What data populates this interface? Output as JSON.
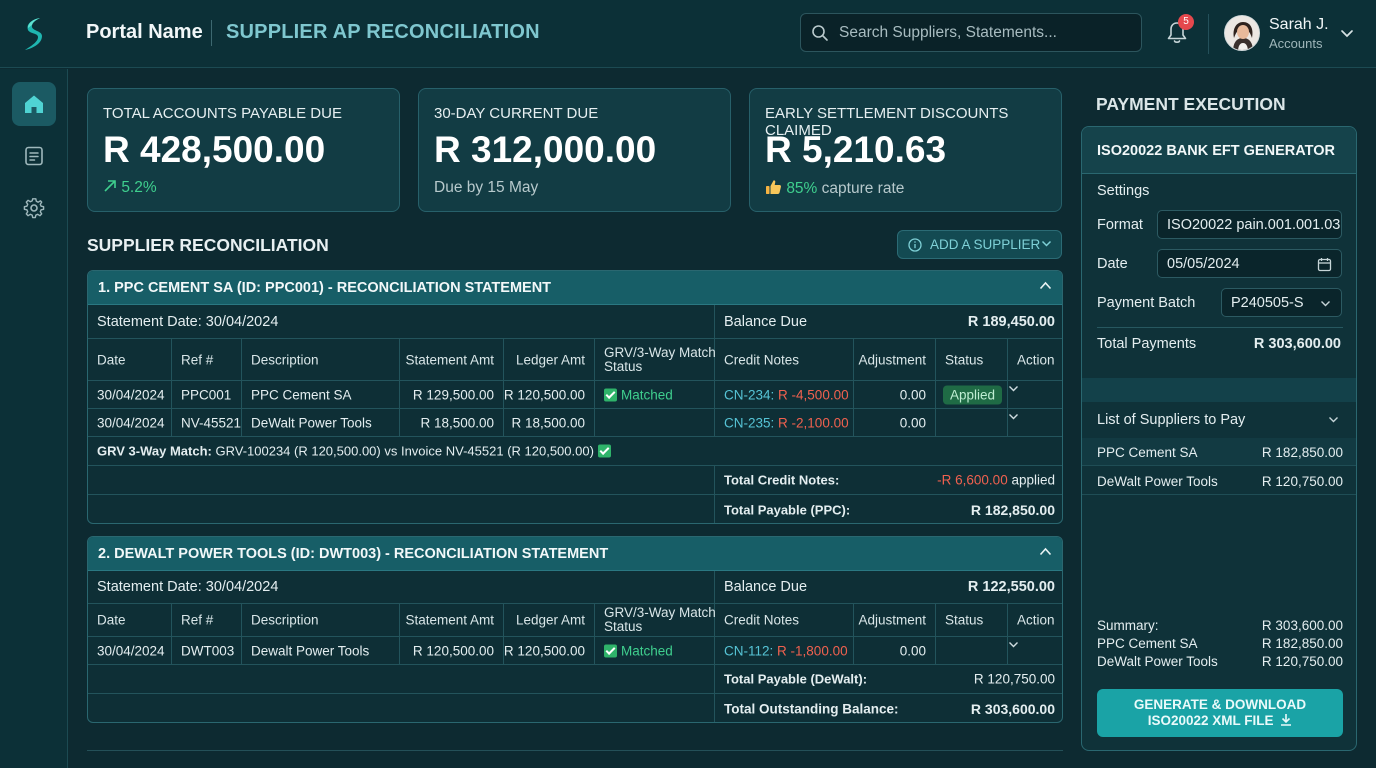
{
  "topbar": {
    "portal_name": "Portal Name",
    "page_title": "SUPPLIER AP RECONCILIATION",
    "search_placeholder": "Search Suppliers, Statements...",
    "notification_count": "5",
    "user_name": "Sarah J.",
    "user_role": "Accounts"
  },
  "sidebar": {
    "items": [
      {
        "icon": "home-icon",
        "active": true
      },
      {
        "icon": "document-icon",
        "active": false
      },
      {
        "icon": "gear-icon",
        "active": false
      }
    ]
  },
  "kpis": [
    {
      "label": "TOTAL ACCOUNTS PAYABLE DUE",
      "value": "R 428,500.00",
      "sub": "5.2%",
      "sub_icon": "arrow-up-right-icon"
    },
    {
      "label": "30-DAY CURRENT DUE",
      "value": "R 312,000.00",
      "sub": "Due by 15 May"
    },
    {
      "label": "EARLY SETTLEMENT DISCOUNTS CLAIMED",
      "value": "R 5,210.63",
      "sub_highlight": "85%",
      "sub_rest": " capture rate",
      "sub_icon": "thumbs-up-icon"
    }
  ],
  "reconciliation": {
    "title": "SUPPLIER RECONCILIATION",
    "add_button": "ADD A SUPPLIER",
    "columns": {
      "date": "Date",
      "ref": "Ref #",
      "description": "Description",
      "statement_amt": "Statement Amt",
      "ledger_amt": "Ledger Amt",
      "grv_line1": "GRV/3-Way Match",
      "grv_line2": "Status",
      "credit_notes": "Credit Notes",
      "adjustment": "Adjustment",
      "status": "Status",
      "action": "Action"
    },
    "statements": [
      {
        "title": "1. PPC CEMENT SA (ID: PPC001) - RECONCILIATION STATEMENT",
        "statement_date": "Statement Date: 30/04/2024",
        "balance_label": "Balance Due",
        "balance_value": "R 189,450.00",
        "rows": [
          {
            "date": "30/04/2024",
            "ref": "PPC001",
            "description": "PPC Cement SA",
            "statement_amt": "R 129,500.00",
            "ledger_amt": "R 120,500.00",
            "grv": "Matched",
            "cn_ref": "CN-234:",
            "cn_amt": "R -4,500.00",
            "adjustment": "0.00",
            "status": "Applied"
          },
          {
            "date": "30/04/2024",
            "ref": "NV-45521",
            "description": "DeWalt Power Tools",
            "statement_amt": "R 18,500.00",
            "ledger_amt": "R 18,500.00",
            "grv": "",
            "cn_ref": "CN-235:",
            "cn_amt": "R -2,100.00",
            "adjustment": "0.00",
            "status": ""
          }
        ],
        "grv_note_label": "GRV 3-Way Match:",
        "grv_note_text": " GRV-100234 (R 120,500.00) vs Invoice NV-45521 (R 120,500.00)",
        "totals": [
          {
            "label": "Total Credit Notes:",
            "value": "-R 6,600.00",
            "suffix": " applied"
          },
          {
            "label": "Total Payable (PPC):",
            "value": "R 182,850.00"
          }
        ]
      },
      {
        "title": "2. DEWALT POWER TOOLS (ID: DWT003) - RECONCILIATION STATEMENT",
        "statement_date": "Statement Date: 30/04/2024",
        "balance_label": "Balance Due",
        "balance_value": "R 122,550.00",
        "rows": [
          {
            "date": "30/04/2024",
            "ref": "DWT003",
            "description": "Dewalt Power Tools",
            "statement_amt": "R 120,500.00",
            "ledger_amt": "R 120,500.00",
            "grv": "Matched",
            "cn_ref": "CN-112:",
            "cn_amt": "R -1,800.00",
            "adjustment": "0.00",
            "status": ""
          }
        ],
        "totals": [
          {
            "label": "Total Payable (DeWalt):",
            "value": "R 120,750.00"
          },
          {
            "label": "Total Outstanding Balance:",
            "value": "R 303,600.00"
          }
        ]
      }
    ]
  },
  "payment": {
    "section_title": "PAYMENT EXECUTION",
    "panel_title": "ISO20022 BANK EFT GENERATOR",
    "settings_label": "Settings",
    "format_label": "Format",
    "format_value": "ISO20022 pain.001.001.03",
    "date_label": "Date",
    "date_value": "05/05/2024",
    "batch_label": "Payment Batch",
    "batch_value": "P240505-S",
    "total_label": "Total Payments",
    "total_value": "R 303,600.00",
    "list_title": "List of Suppliers to Pay",
    "suppliers": [
      {
        "name": "PPC Cement SA",
        "amount": "R 182,850.00"
      },
      {
        "name": "DeWalt Power Tools",
        "amount": "R 120,750.00"
      }
    ],
    "summary": [
      {
        "name": "Summary:",
        "amount": "R 303,600.00"
      },
      {
        "name": "PPC Cement SA",
        "amount": "R 182,850.00"
      },
      {
        "name": "DeWalt Power Tools",
        "amount": "R 120,750.00"
      }
    ],
    "generate_line1": "GENERATE & DOWNLOAD",
    "generate_line2": "ISO20022 XML FILE"
  },
  "colors": {
    "accent": "#1aa3a6",
    "matched": "#3fcf8e",
    "credit_ref": "#56c4d6",
    "negative": "#f0614f"
  }
}
